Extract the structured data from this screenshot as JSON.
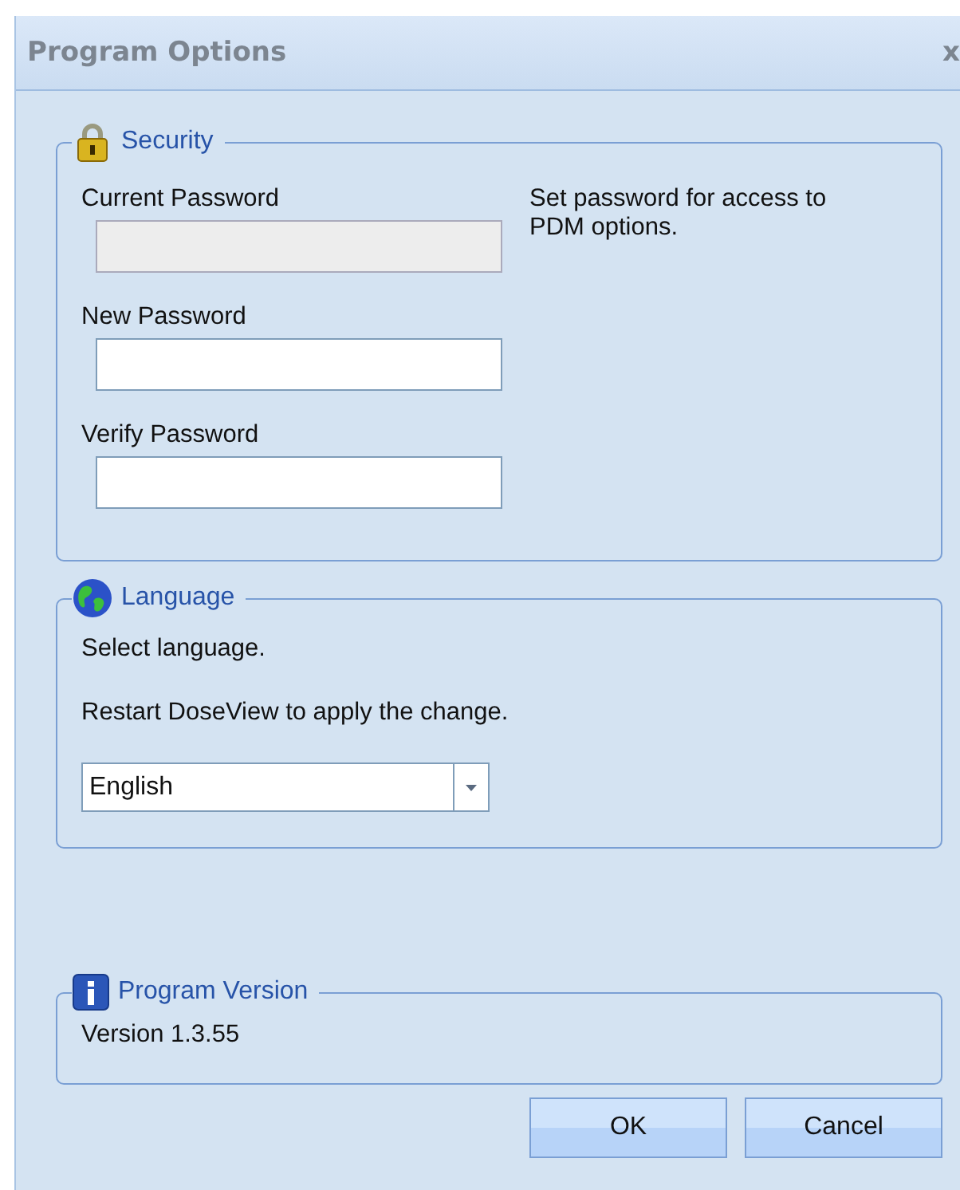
{
  "window": {
    "title": "Program Options",
    "close": "x"
  },
  "security": {
    "title": "Security",
    "fields": [
      {
        "label": "Current Password",
        "disabled": true
      },
      {
        "label": "New Password",
        "disabled": false
      },
      {
        "label": "Verify Password",
        "disabled": false
      }
    ],
    "note": "Set password for access to PDM options."
  },
  "language": {
    "title": "Language",
    "lines": [
      "Select language.",
      "Restart DoseView to apply the change."
    ],
    "value": "English"
  },
  "version": {
    "title": "Program Version",
    "text": "Version 1.3.55"
  },
  "buttons": [
    "OK",
    "Cancel"
  ]
}
